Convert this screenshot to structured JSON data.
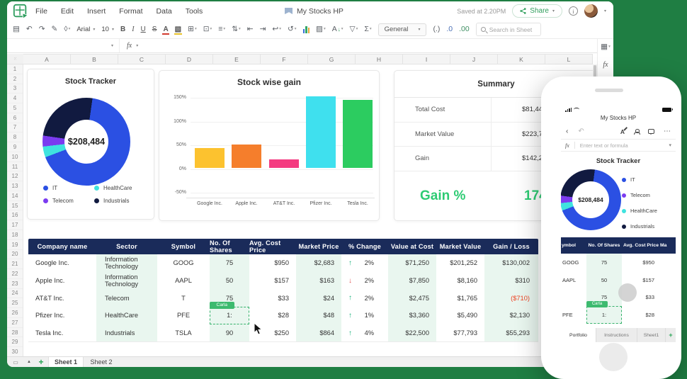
{
  "app": {
    "menu": [
      "File",
      "Edit",
      "Insert",
      "Format",
      "Data",
      "Tools"
    ],
    "doc_title": "My Stocks HP",
    "saved": "Saved at 2.20PM",
    "share": "Share",
    "fx_label": "fx",
    "add_sheet": "+",
    "toolbar": {
      "font": "Arial",
      "size": "10",
      "format": "General",
      "search_placeholder": "Search in Sheet"
    },
    "sheet_tabs": [
      "Sheet 1",
      "Sheet 2"
    ]
  },
  "grid": {
    "cols": [
      "A",
      "B",
      "C",
      "D",
      "E",
      "F",
      "G",
      "H",
      "I",
      "J",
      "K",
      "L"
    ],
    "rows": [
      "1",
      "2",
      "3",
      "4",
      "5",
      "6",
      "7",
      "8",
      "9",
      "10",
      "11",
      "12",
      "13",
      "14",
      "15",
      "16",
      "17",
      "18",
      "19",
      "20",
      "21",
      "22",
      "23",
      "24",
      "25",
      "26",
      "27",
      "28",
      "29",
      "30"
    ]
  },
  "chart_data": [
    {
      "type": "pie",
      "title": "Stock Tracker",
      "center_label": "$208,484",
      "slices": [
        {
          "label": "IT",
          "pct": 67,
          "color": "#2b50e3"
        },
        {
          "label": "HealthCare",
          "pct": 4,
          "color": "#3fe3df"
        },
        {
          "label": "Telecom",
          "pct": 4,
          "color": "#7b3bf0"
        },
        {
          "label": "Industrials",
          "pct": 25,
          "color": "#111a40"
        }
      ],
      "start_deg": 8,
      "legend_position": "bottom"
    },
    {
      "type": "bar",
      "title": "Stock wise gain",
      "categories": [
        "Google Inc.",
        "Apple Inc.",
        "AT&T Inc.",
        "Pfizer Inc.",
        "Tesla Inc."
      ],
      "values": [
        41,
        49,
        17,
        150,
        143
      ],
      "unit": "%",
      "colors": [
        "#fcc22f",
        "#f57e2c",
        "#f43b80",
        "#3fe0ee",
        "#2ccc60"
      ],
      "yticks": [
        "150%",
        "100%",
        "50%",
        "0%",
        "-50%"
      ],
      "ylim": [
        -50,
        150
      ],
      "grid": true
    }
  ],
  "summary": {
    "title": "Summary",
    "rows": [
      {
        "label": "Total Cost",
        "value": "$81,44"
      },
      {
        "label": "Market Value",
        "value": "$223,7"
      },
      {
        "label": "Gain",
        "value": "$142,2"
      }
    ],
    "gain_label": "Gain %",
    "gain_value": "174."
  },
  "table": {
    "headers": [
      "Company name",
      "Sector",
      "Symbol",
      "No. Of Shares",
      "Avg. Cost Price",
      "Market Price",
      "% Change",
      "Value at Cost",
      "Market Value",
      "Gain / Loss"
    ],
    "rows": [
      {
        "company": "Google Inc.",
        "sector": "Information Technology",
        "symbol": "GOOG",
        "shares": "75",
        "avg_cost": "$950",
        "market_price": "$2,683",
        "arrow": "up",
        "change": "2%",
        "value_at_cost": "$71,250",
        "market_value": "$201,252",
        "gain_loss": "$130,002"
      },
      {
        "company": "Apple Inc.",
        "sector": "Information Technology",
        "symbol": "AAPL",
        "shares": "50",
        "avg_cost": "$157",
        "market_price": "$163",
        "arrow": "down",
        "change": "2%",
        "value_at_cost": "$7,850",
        "market_value": "$8,160",
        "gain_loss": "$310"
      },
      {
        "company": "AT&T Inc.",
        "sector": "Telecom",
        "symbol": "T",
        "shares": "75",
        "avg_cost": "$33",
        "market_price": "$24",
        "arrow": "up",
        "change": "2%",
        "value_at_cost": "$2,475",
        "market_value": "$1,765",
        "gain_loss": "($710)"
      },
      {
        "company": "Pfizer Inc.",
        "sector": "HealthCare",
        "symbol": "PFE",
        "shares": "1:",
        "avg_cost": "$28",
        "market_price": "$48",
        "arrow": "up",
        "change": "1%",
        "value_at_cost": "$3,360",
        "market_value": "$5,490",
        "gain_loss": "$2,130",
        "editing": true
      },
      {
        "company": "Tesla Inc.",
        "sector": "Industrials",
        "symbol": "TSLA",
        "shares": "90",
        "avg_cost": "$250",
        "market_price": "$864",
        "arrow": "up",
        "change": "4%",
        "value_at_cost": "$22,500",
        "market_value": "$77,793",
        "gain_loss": "$55,293"
      }
    ],
    "collaborator": "Carla"
  },
  "phone": {
    "title": "My Stocks HP",
    "fx_label": "fx",
    "formula_placeholder": "Enter text or formula",
    "chart_title": "Stock Tracker",
    "center_label": "$208,484",
    "table": {
      "headers": [
        "ymbol",
        "No. Of Shares",
        "Avg. Cost Price",
        "Ma"
      ],
      "rows": [
        [
          "GOOG",
          "75",
          "$950",
          ""
        ],
        [
          "AAPL",
          "50",
          "$157",
          ""
        ],
        [
          "",
          "75",
          "$33",
          ""
        ],
        [
          "PFE",
          "1:",
          "$28",
          ""
        ]
      ],
      "editing_row": 3
    },
    "collaborator": "Carla",
    "tabs": [
      "Portfolio",
      "Instructions",
      "Sheet1"
    ],
    "add_sheet": "+"
  },
  "colors": {
    "stage_green": "#1f7e43",
    "table_header_navy": "#1a2b5a",
    "mint_column": "#e9f6ef",
    "gain_green": "#2dcb73",
    "loss_red": "#ee4323",
    "up_arrow": "#19b27c",
    "down_arrow": "#e05858",
    "accent_green": "#26a454"
  }
}
